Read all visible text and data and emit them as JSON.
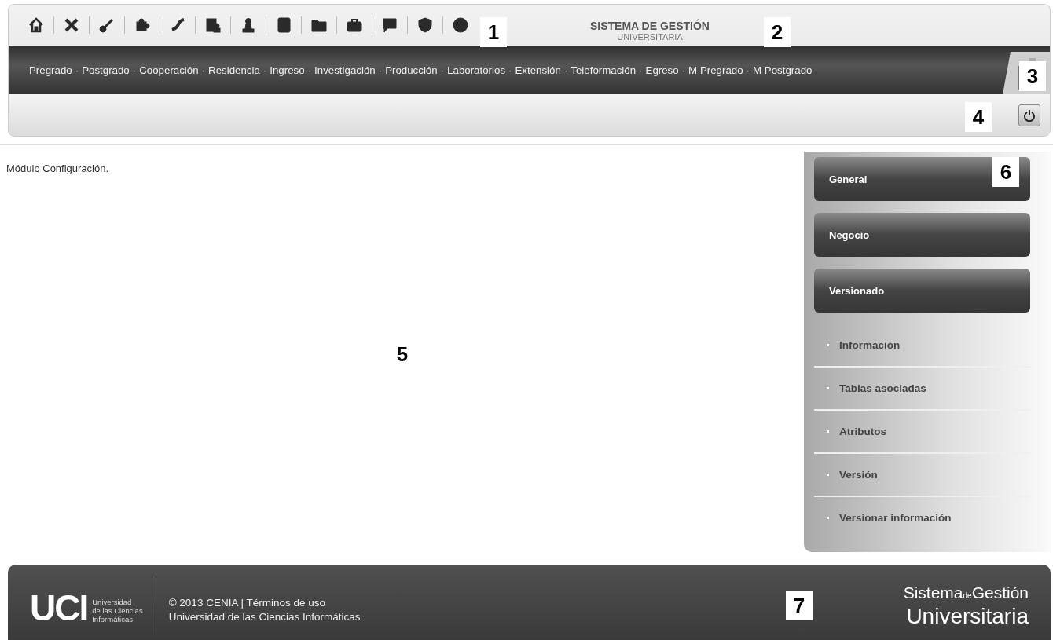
{
  "header": {
    "title": "SISTEMA DE GESTIÓN",
    "subtitle": "UNIVERSITARIA"
  },
  "nav": {
    "separator": "·",
    "links": [
      "Pregrado",
      "Postgrado",
      "Cooperación",
      "Residencia",
      "Ingreso",
      "Investigación",
      "Producción",
      "Laboratorios",
      "Extensión",
      "Teleformación",
      "Egreso",
      "M Pregrado",
      "M Postgrado"
    ]
  },
  "content": {
    "text": "Módulo Configuración."
  },
  "sidebar": {
    "buttons": [
      "General",
      "Negocio",
      "Versionado"
    ],
    "items": [
      "Información",
      "Tablas asociadas",
      "Atributos",
      "Versión",
      "Versionar información"
    ]
  },
  "footer": {
    "logo_name": "UCI",
    "logo_lines": [
      "Universidad",
      "de las Ciencias",
      "Informáticas"
    ],
    "copyright": "© 2013 CENIA |",
    "terms_link": "Términos de uso",
    "institution": "Universidad de las Ciencias Informáticas",
    "brand_top": [
      "Sistema",
      "de",
      "Gestión"
    ],
    "brand_bottom": "Universitaria"
  },
  "callouts": [
    "1",
    "2",
    "3",
    "4",
    "5",
    "6",
    "7"
  ]
}
